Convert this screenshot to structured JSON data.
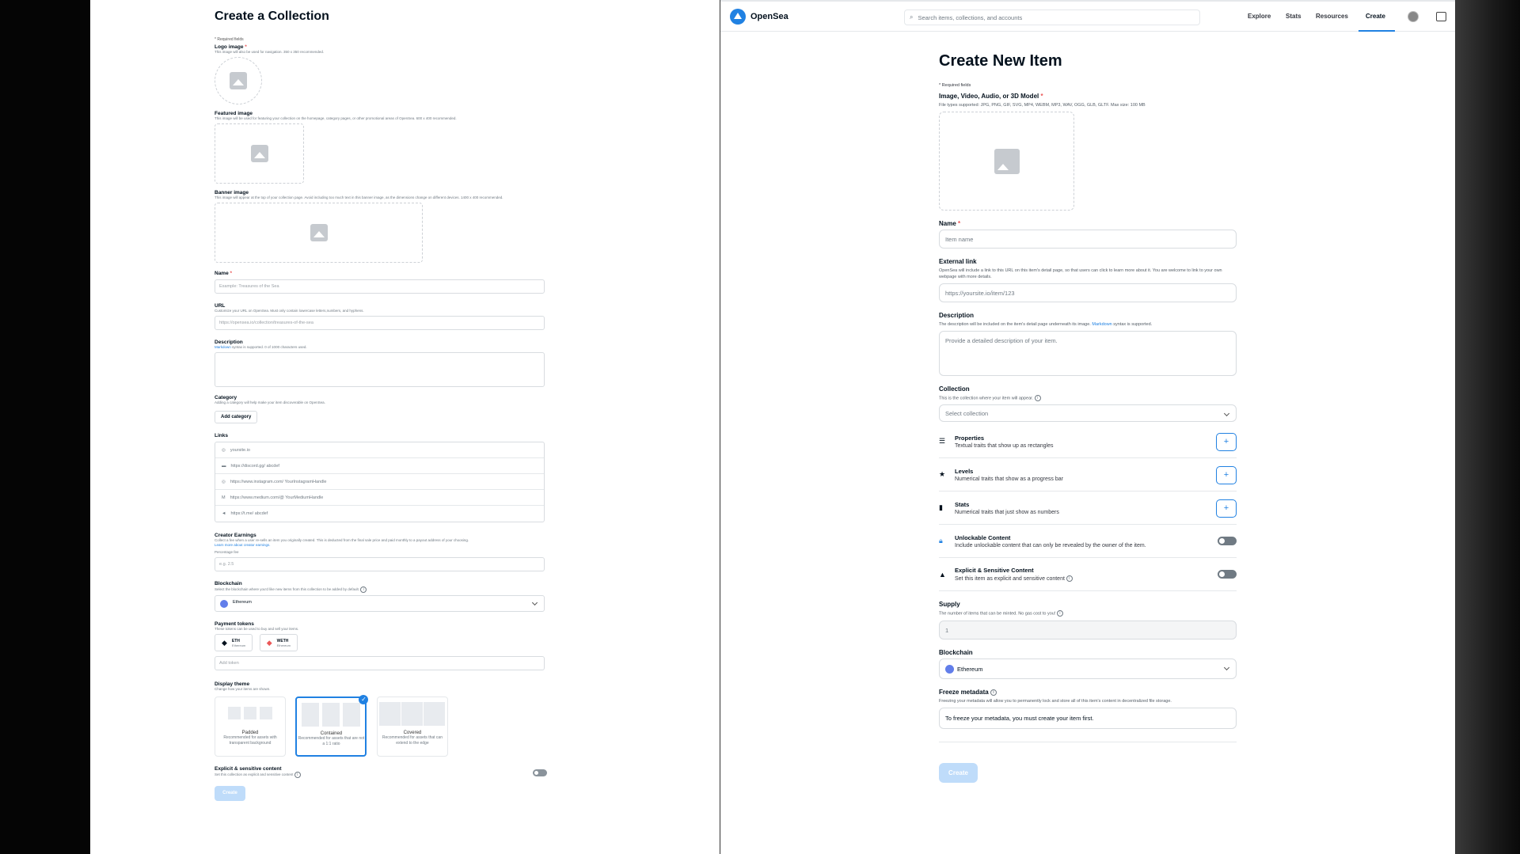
{
  "left": {
    "title": "Create a Collection",
    "required_note": "* Required fields",
    "logo": {
      "label": "Logo image",
      "desc": "This image will also be used for navigation. 350 x 350 recommended."
    },
    "featured": {
      "label": "Featured image",
      "desc": "This image will be used for featuring your collection on the homepage, category pages, or other promotional areas of OpenSea. 600 x 400 recommended."
    },
    "banner": {
      "label": "Banner image",
      "desc": "This image will appear at the top of your collection page. Avoid including too much text in this banner image, as the dimensions change on different devices. 1400 x 400 recommended."
    },
    "name": {
      "label": "Name",
      "placeholder": "Example: Treasures of the Sea"
    },
    "url": {
      "label": "URL",
      "desc": "Customize your URL on OpenSea. Must only contain lowercase letters,numbers, and hyphens.",
      "placeholder": "https://opensea.io/collection/treasures-of-the-sea"
    },
    "description": {
      "label": "Description",
      "markdown": "Markdown",
      "desc": "syntax is supported. 0 of 1000 characters used."
    },
    "category": {
      "label": "Category",
      "desc": "Adding a category will help make your item discoverable on OpenSea.",
      "button": "Add category"
    },
    "links": {
      "label": "Links",
      "rows": [
        "yoursite.io",
        "https://discord.gg/ abcdef",
        "https://www.instagram.com/ YourInstagramHandle",
        "https://www.medium.com/@ YourMediumHandle",
        "https://t.me/ abcdef"
      ],
      "icons": [
        "globe-icon",
        "discord-icon",
        "instagram-icon",
        "medium-icon",
        "telegram-icon"
      ],
      "glyphs": [
        "◎",
        "▬",
        "◎",
        "M",
        "◄"
      ]
    },
    "earnings": {
      "label": "Creator Earnings",
      "desc": "Collect a fee when a user re-sells an item you originally created. This is deducted from the final sale price and paid monthly to a payout address of your choosing.",
      "learn": "Learn more about creator earnings.",
      "fee_label": "Percentage fee",
      "fee_placeholder": "e.g. 2.5"
    },
    "blockchain": {
      "label": "Blockchain",
      "desc": "Select the blockchain where you'd like new items from this collection to be added by default.",
      "value": "Ethereum"
    },
    "payment": {
      "label": "Payment tokens",
      "desc": "These tokens can be used to buy and sell your items.",
      "tokens": [
        {
          "symbol": "ETH",
          "chain": "Ethereum"
        },
        {
          "symbol": "WETH",
          "chain": "Ethereum"
        }
      ],
      "add_token": "Add token"
    },
    "theme": {
      "label": "Display theme",
      "desc": "Change how your items are shown.",
      "options": [
        {
          "name": "Padded",
          "desc": "Recommended for assets with transparent background"
        },
        {
          "name": "Contained",
          "desc": "Recommended for assets that are not a 1:1 ratio"
        },
        {
          "name": "Covered",
          "desc": "Recommended for assets that can extend to the edge"
        }
      ],
      "selected": "Contained"
    },
    "explicit": {
      "label": "Explicit & sensitive content",
      "desc": "Set this collection as explicit and sensitive content"
    },
    "create": "Create"
  },
  "right": {
    "brand": "OpenSea",
    "search_placeholder": "Search items, collections, and accounts",
    "nav": [
      "Explore",
      "Stats",
      "Resources",
      "Create"
    ],
    "active_nav": "Create",
    "title": "Create New Item",
    "required_note": "* Required fields",
    "media": {
      "label": "Image, Video, Audio, or 3D Model",
      "desc": "File types supported: JPG, PNG, GIF, SVG, MP4, WEBM, MP3, WAV, OGG, GLB, GLTF. Max size: 100 MB"
    },
    "name": {
      "label": "Name",
      "placeholder": "Item name"
    },
    "external": {
      "label": "External link",
      "desc": "OpenSea will include a link to this URL on this item's detail page, so that users can click to learn more about it. You are welcome to link to your own webpage with more details.",
      "placeholder": "https://yoursite.io/item/123"
    },
    "description": {
      "label": "Description",
      "desc_pre": "The description will be included on the item's detail page underneath its image.",
      "markdown": "Markdown",
      "desc_post": "syntax is supported.",
      "placeholder": "Provide a detailed description of your item."
    },
    "collection": {
      "label": "Collection",
      "desc": "This is the collection where your item will appear.",
      "placeholder": "Select collection"
    },
    "traits": [
      {
        "title": "Properties",
        "desc": "Textual traits that show up as rectangles",
        "icon": "list-icon"
      },
      {
        "title": "Levels",
        "desc": "Numerical traits that show as a progress bar",
        "icon": "star-icon"
      },
      {
        "title": "Stats",
        "desc": "Numerical traits that just show as numbers",
        "icon": "bar-chart-icon"
      }
    ],
    "unlockable": {
      "title": "Unlockable Content",
      "desc": "Include unlockable content that can only be revealed by the owner of the item."
    },
    "explicit": {
      "title": "Explicit & Sensitive Content",
      "desc": "Set this item as explicit and sensitive content"
    },
    "supply": {
      "label": "Supply",
      "desc": "The number of items that can be minted. No gas cost to you!",
      "value": "1"
    },
    "blockchain": {
      "label": "Blockchain",
      "value": "Ethereum"
    },
    "freeze": {
      "label": "Freeze metadata",
      "desc": "Freezing your metadata will allow you to permanently lock and store all of this item's content in decentralized file storage.",
      "value": "To freeze your metadata, you must create your item first."
    },
    "create": "Create"
  }
}
